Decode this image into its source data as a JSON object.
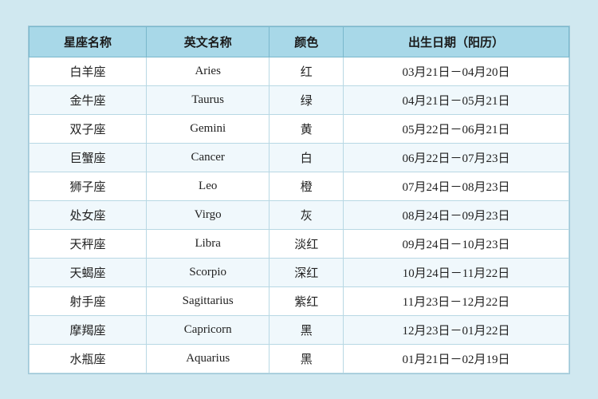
{
  "table": {
    "headers": [
      "星座名称",
      "英文名称",
      "颜色",
      "出生日期（阳历）"
    ],
    "rows": [
      {
        "chinese": "白羊座",
        "english": "Aries",
        "color": "红",
        "dates": "03月21日－04月20日"
      },
      {
        "chinese": "金牛座",
        "english": "Taurus",
        "color": "绿",
        "dates": "04月21日－05月21日"
      },
      {
        "chinese": "双子座",
        "english": "Gemini",
        "color": "黄",
        "dates": "05月22日－06月21日"
      },
      {
        "chinese": "巨蟹座",
        "english": "Cancer",
        "color": "白",
        "dates": "06月22日－07月23日"
      },
      {
        "chinese": "狮子座",
        "english": "Leo",
        "color": "橙",
        "dates": "07月24日－08月23日"
      },
      {
        "chinese": "处女座",
        "english": "Virgo",
        "color": "灰",
        "dates": "08月24日－09月23日"
      },
      {
        "chinese": "天秤座",
        "english": "Libra",
        "color": "淡红",
        "dates": "09月24日－10月23日"
      },
      {
        "chinese": "天蝎座",
        "english": "Scorpio",
        "color": "深红",
        "dates": "10月24日－11月22日"
      },
      {
        "chinese": "射手座",
        "english": "Sagittarius",
        "color": "紫红",
        "dates": "11月23日－12月22日"
      },
      {
        "chinese": "摩羯座",
        "english": "Capricorn",
        "color": "黑",
        "dates": "12月23日－01月22日"
      },
      {
        "chinese": "水瓶座",
        "english": "Aquarius",
        "color": "黑",
        "dates": "01月21日－02月19日"
      }
    ]
  }
}
